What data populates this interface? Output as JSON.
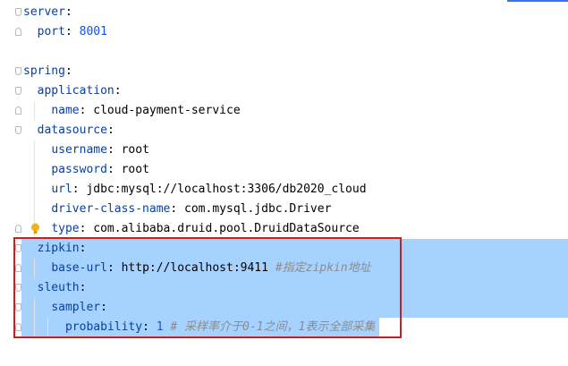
{
  "lines": [
    {
      "indent": 0,
      "key": "server",
      "value": "",
      "value_type": "",
      "comment": ""
    },
    {
      "indent": 1,
      "key": "port",
      "value": "8001",
      "value_type": "number",
      "comment": ""
    },
    {
      "indent": 0,
      "key": "",
      "value": "",
      "value_type": "",
      "comment": ""
    },
    {
      "indent": 0,
      "key": "spring",
      "value": "",
      "value_type": "",
      "comment": ""
    },
    {
      "indent": 1,
      "key": "application",
      "value": "",
      "value_type": "",
      "comment": ""
    },
    {
      "indent": 2,
      "key": "name",
      "value": "cloud-payment-service",
      "value_type": "string",
      "comment": ""
    },
    {
      "indent": 1,
      "key": "datasource",
      "value": "",
      "value_type": "",
      "comment": ""
    },
    {
      "indent": 2,
      "key": "username",
      "value": "root",
      "value_type": "string",
      "comment": ""
    },
    {
      "indent": 2,
      "key": "password",
      "value": "root",
      "value_type": "string",
      "comment": ""
    },
    {
      "indent": 2,
      "key": "url",
      "value": "jdbc:mysql://localhost:3306/db2020_cloud",
      "value_type": "string",
      "comment": ""
    },
    {
      "indent": 2,
      "key": "driver-class-name",
      "value": "com.mysql.jdbc.Driver",
      "value_type": "string",
      "comment": ""
    },
    {
      "indent": 2,
      "key": "type",
      "value": "com.alibaba.druid.pool.DruidDataSource",
      "value_type": "string",
      "comment": ""
    },
    {
      "indent": 1,
      "key": "zipkin",
      "value": "",
      "value_type": "",
      "comment": ""
    },
    {
      "indent": 2,
      "key": "base-url",
      "value": "http://localhost:9411",
      "value_type": "string",
      "comment": "#指定zipkin地址"
    },
    {
      "indent": 1,
      "key": "sleuth",
      "value": "",
      "value_type": "",
      "comment": ""
    },
    {
      "indent": 2,
      "key": "sampler",
      "value": "",
      "value_type": "",
      "comment": ""
    },
    {
      "indent": 3,
      "key": "probability",
      "value": "1",
      "value_type": "number",
      "comment": "# 采样率介于0-1之间，1表示全部采集"
    }
  ],
  "colors": {
    "key": "#0b3f9e",
    "number": "#1750eb",
    "comment": "#8c8c8c",
    "selection": "#a6d2ff",
    "highlight_box": "#cc1f1f"
  },
  "icons": {
    "intention": "lightbulb-icon",
    "fold": "fold-marker-icon"
  }
}
